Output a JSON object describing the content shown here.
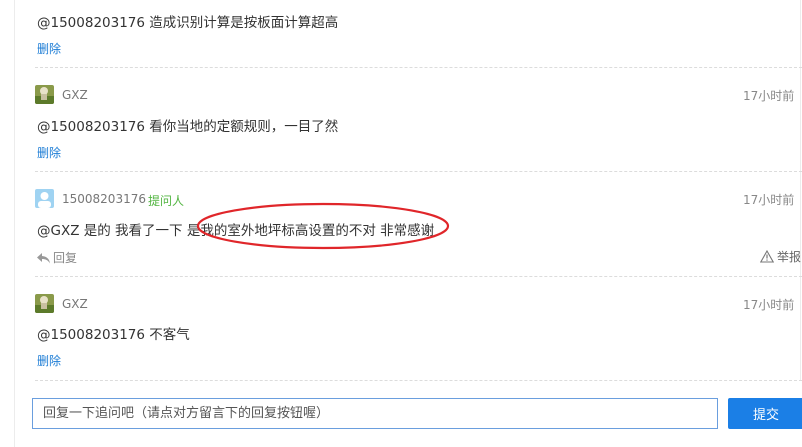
{
  "comments": [
    {
      "message": "@15008203176 造成识别计算是按板面计算超高",
      "delete_label": "删除"
    },
    {
      "user": "GXZ",
      "avatar_icon": "user-avatar-icon",
      "time": "17小时前",
      "message": "@15008203176 看你当地的定额规则，一目了然",
      "delete_label": "删除"
    },
    {
      "user": "15008203176",
      "badge": "提问人",
      "avatar_icon": "default-avatar-icon",
      "time": "17小时前",
      "message": "@GXZ 是的 我看了一下 是我的室外地坪标高设置的不对 非常感谢",
      "reply_label": "回复",
      "report_label": "举报"
    },
    {
      "user": "GXZ",
      "avatar_icon": "user-avatar-icon",
      "time": "17小时前",
      "message": "@15008203176 不客气",
      "delete_label": "删除"
    }
  ],
  "reply_box": {
    "placeholder": "回复一下追问吧（请点对方留言下的回复按钮喔）",
    "submit_label": "提交"
  },
  "colors": {
    "link": "#1c7cd5",
    "badge": "#52b541",
    "submit": "#1b7fe6",
    "annotation": "#e0262a"
  }
}
